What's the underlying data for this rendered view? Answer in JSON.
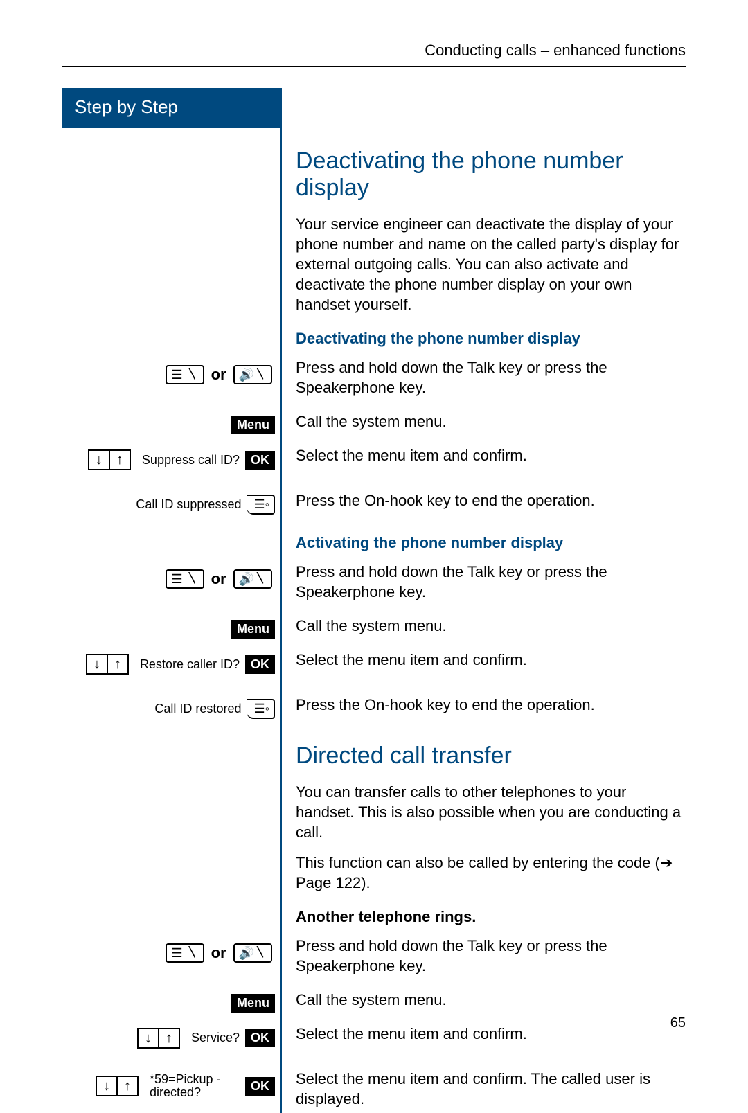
{
  "header": "Conducting calls – enhanced functions",
  "sidebar_title": "Step by Step",
  "or_label": "or",
  "menu_label": "Menu",
  "ok_label": "OK",
  "section1": {
    "title": "Deactivating the phone number display",
    "intro": "Your service engineer can deactivate the display of your phone number and name on the called party's display for external outgoing calls. You can also activate and deactivate the phone number display on your own handset yourself.",
    "deact_heading": "Deactivating the phone number display",
    "act_heading": "Activating the phone number display",
    "steps_deact": {
      "s1": "Press and hold down the Talk key or press the Speakerphone key.",
      "s2": "Call the system menu.",
      "s3_left": "Suppress call ID?",
      "s3": "Select the menu item and confirm.",
      "s4_left": "Call ID suppressed",
      "s4": "Press the On-hook key to end the operation."
    },
    "steps_act": {
      "s1": "Press and hold down the Talk key or press the Speakerphone key.",
      "s2": "Call the system menu.",
      "s3_left": "Restore caller ID?",
      "s3": "Select the menu item and confirm.",
      "s4_left": "Call ID restored",
      "s4": "Press the On-hook key to end the operation."
    }
  },
  "section2": {
    "title": "Directed call transfer",
    "intro1": "You can transfer calls to other telephones to your handset. This is also possible when you are conducting a call.",
    "intro2_pre": "This function can also be called by entering the code (",
    "intro2_link": "Page 122",
    "intro2_post": ").",
    "ring_heading": "Another telephone rings.",
    "steps": {
      "s1": "Press and hold down the Talk key or press the Speakerphone key.",
      "s2": "Call the system menu.",
      "s3_left": "Service?",
      "s3": "Select the menu item and confirm.",
      "s4_left": "*59=Pickup - directed?",
      "s4": "Select the menu item and confirm. The called user is displayed."
    }
  },
  "page_number": "65"
}
